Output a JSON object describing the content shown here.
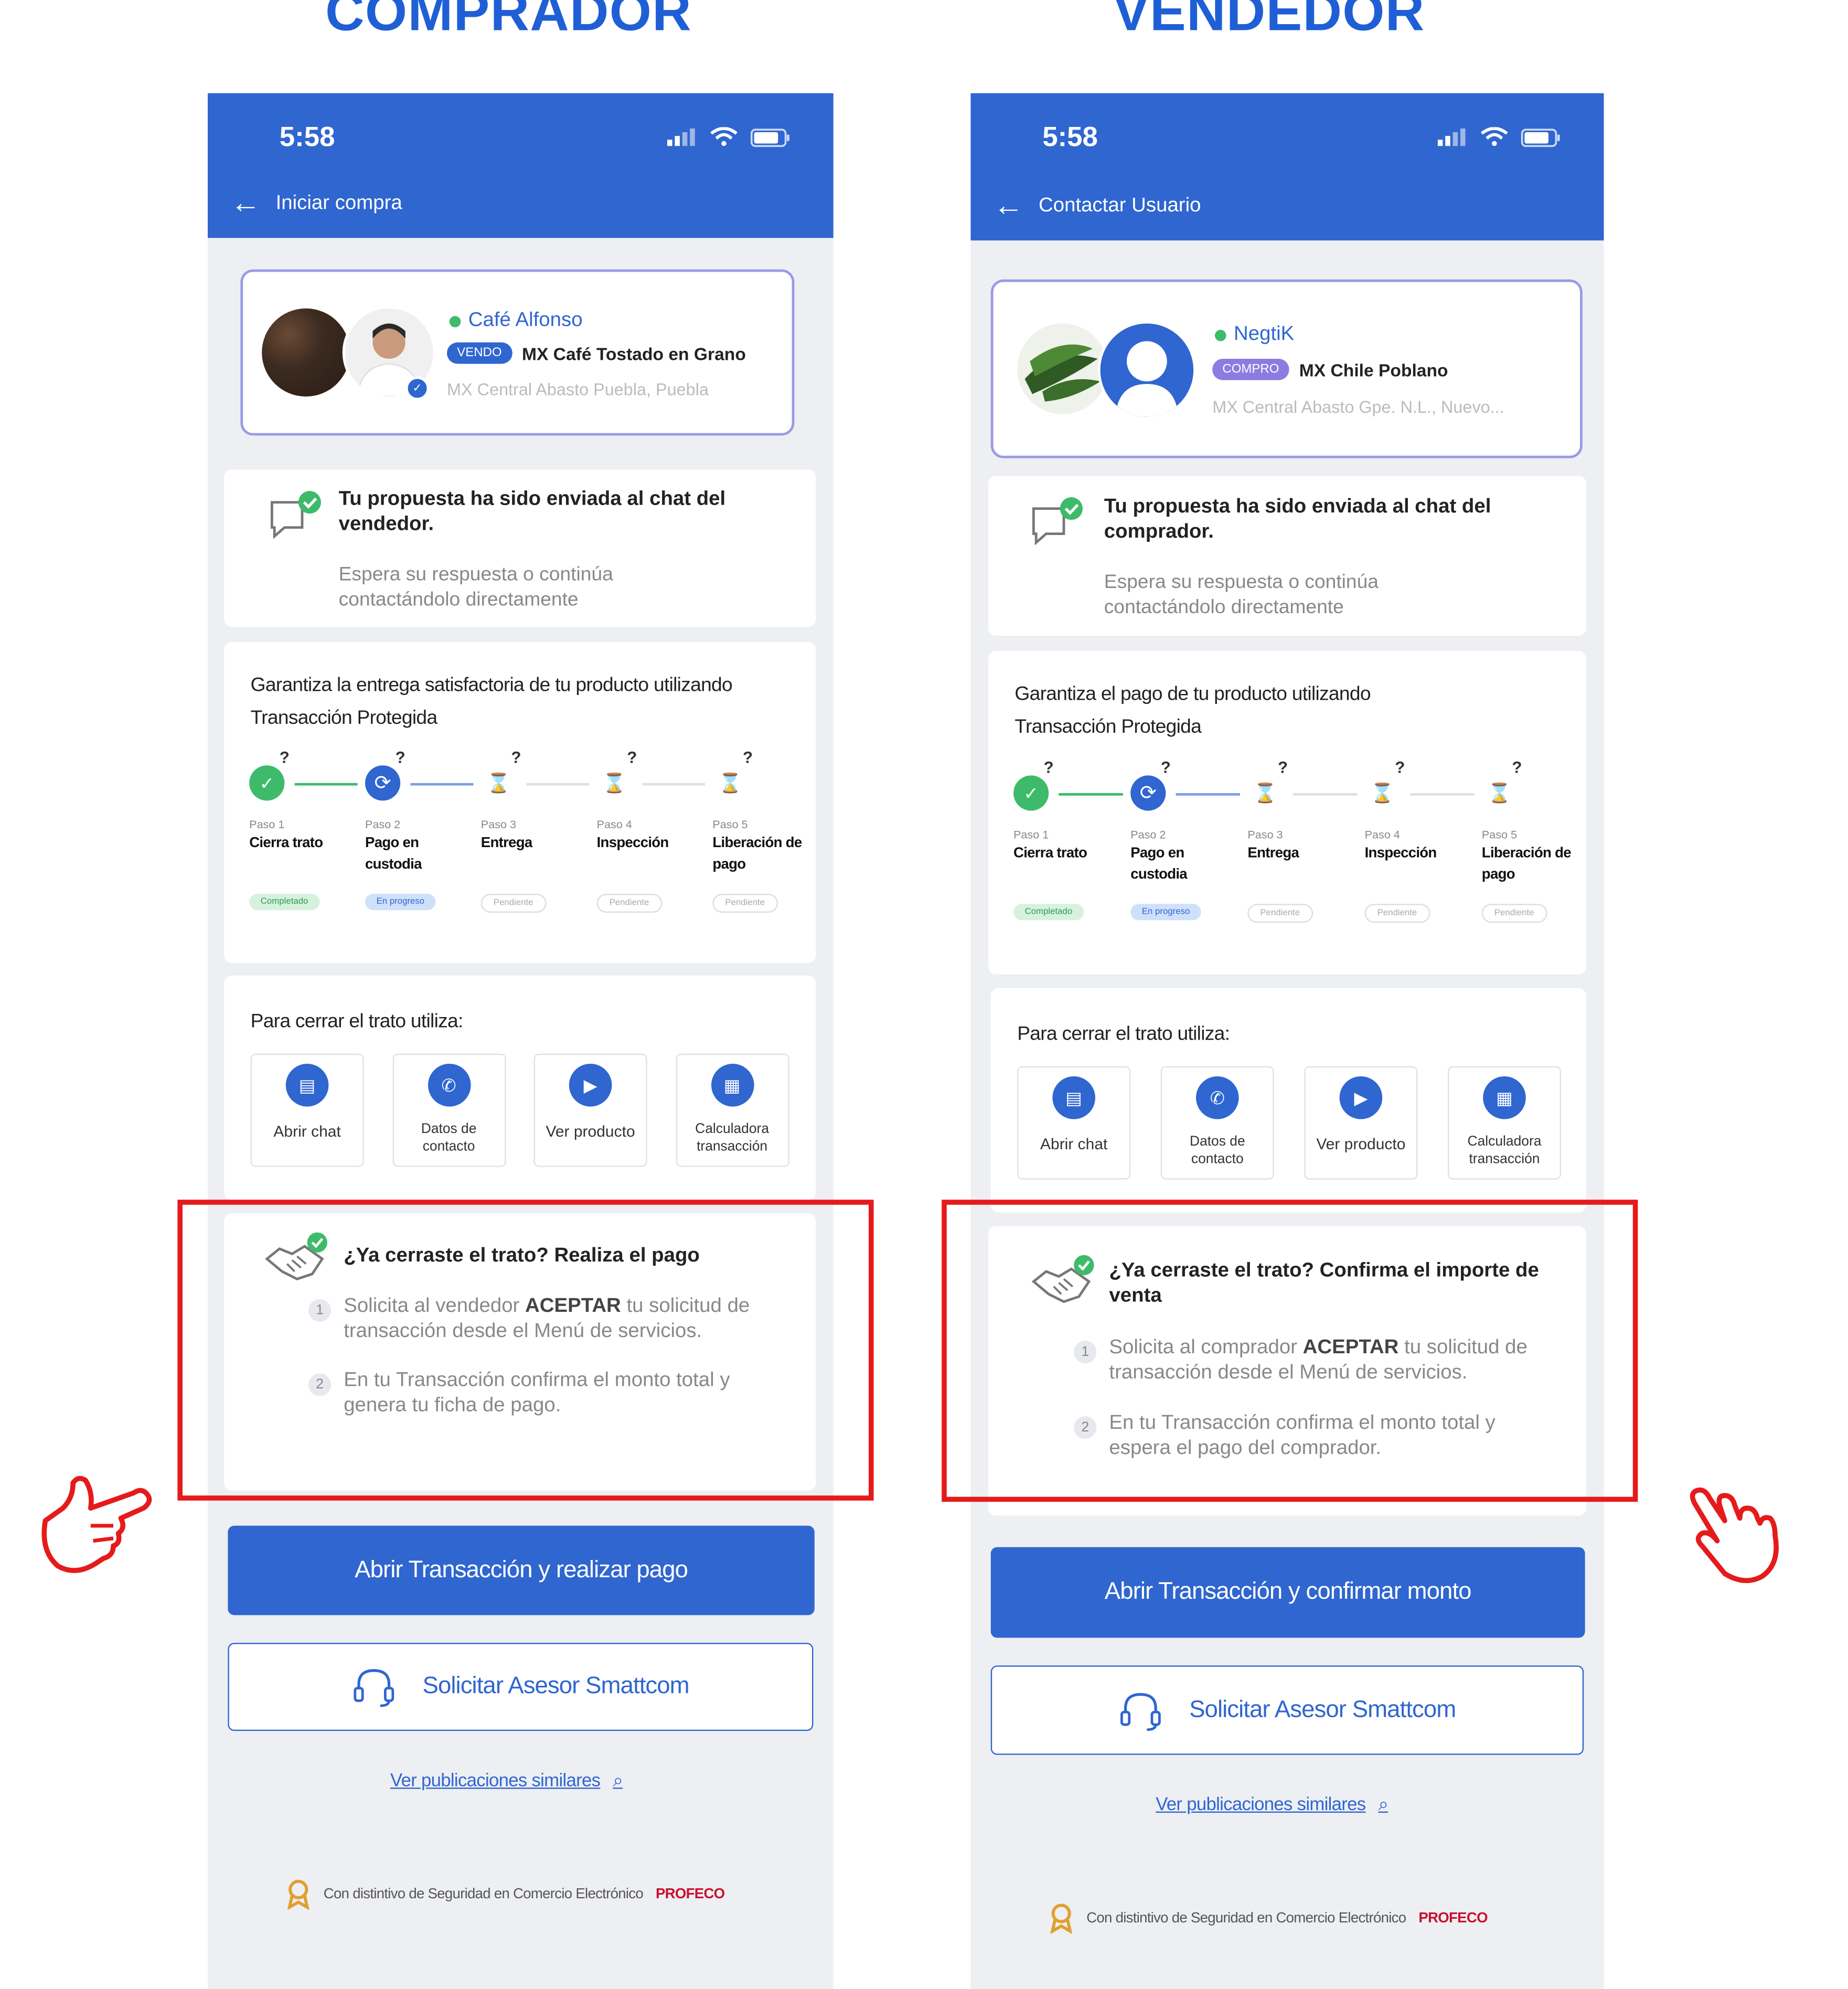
{
  "titles": {
    "left": "COMPRADOR",
    "right": "VENDEDOR"
  },
  "comprador": {
    "status_time": "5:58",
    "nav_title": "Iniciar compra",
    "seller_name": "Café Alfonso",
    "tag": "VENDO",
    "product": "MX Café Tostado en Grano",
    "location": "MX Central Abasto Puebla, Puebla",
    "msg_title": "Tu propuesta ha sido enviada al chat del vendedor.",
    "msg_sub": "Espera su respuesta o continúa contactándolo directamente",
    "guarantee": "Garantiza la entrega satisfactoria de tu producto utilizando Transacción Protegida",
    "pay_title": "¿Ya cerraste el trato? Realiza el pago",
    "pay_step1_pre": "Solicita al vendedor ",
    "pay_step1_strong": "ACEPTAR",
    "pay_step1_post": " tu solicitud de transacción desde el Menú de servicios.",
    "pay_step2": "En tu Transacción confirma el monto total y genera tu ficha de pago.",
    "primary_button": "Abrir Transacción y realizar pago"
  },
  "vendedor": {
    "status_time": "5:58",
    "nav_title": "Contactar Usuario",
    "seller_name": "NegtiK",
    "tag": "COMPRO",
    "product": "MX Chile Poblano",
    "location": "MX Central Abasto Gpe. N.L., Nuevo...",
    "msg_title": "Tu propuesta ha sido enviada al chat del comprador.",
    "msg_sub": "Espera su respuesta o continúa contactándolo directamente",
    "guarantee": "Garantiza el pago de tu producto utilizando Transacción Protegida",
    "pay_title": "¿Ya cerraste el trato? Confirma el importe de venta",
    "pay_step1_pre": "Solicita al comprador ",
    "pay_step1_strong": "ACEPTAR",
    "pay_step1_post": " tu solicitud de transacción desde el Menú de servicios.",
    "pay_step2": "En tu Transacción confirma el monto total y espera el pago del comprador.",
    "primary_button": "Abrir Transacción y confirmar monto"
  },
  "steps": [
    {
      "paso": "Paso 1",
      "name": "Cierra trato",
      "status": "Completado"
    },
    {
      "paso": "Paso 2",
      "name": "Pago en custodia",
      "status": "En progreso"
    },
    {
      "paso": "Paso 3",
      "name": "Entrega",
      "status": "Pendiente"
    },
    {
      "paso": "Paso 4",
      "name": "Inspección",
      "status": "Pendiente"
    },
    {
      "paso": "Paso 5",
      "name": "Liberación de pago",
      "status": "Pendiente"
    }
  ],
  "step_question_mark": "?",
  "close_deal_title": "Para cerrar el trato utiliza:",
  "tools": [
    {
      "label": "Abrir chat",
      "icon": "chat-icon"
    },
    {
      "label": "Datos de contacto",
      "icon": "phone-icon"
    },
    {
      "label": "Ver producto",
      "icon": "video-icon"
    },
    {
      "label": "Calculadora transacción",
      "icon": "calculator-icon"
    }
  ],
  "step_numbers": [
    "1",
    "2"
  ],
  "advisor_button": "Solicitar Asesor Smattcom",
  "similar_link": "Ver publicaciones similares",
  "footer_text": "Con distintivo de Seguridad en Comercio Electrónico",
  "footer_brand": "PROFECO",
  "colors": {
    "primary": "#2f66d0",
    "success": "#3dbb6a",
    "highlight": "#e51b1b",
    "brand": "#c8102e"
  }
}
